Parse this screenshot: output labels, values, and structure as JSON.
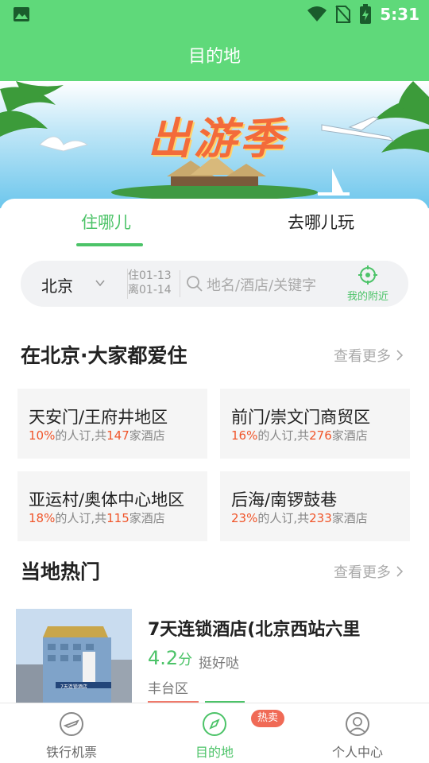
{
  "status_bar": {
    "time": "5:31"
  },
  "header": {
    "title": "目的地"
  },
  "banner": {
    "title": "出游季"
  },
  "tabs": [
    {
      "label": "住哪儿",
      "active": true
    },
    {
      "label": "去哪儿玩",
      "active": false
    }
  ],
  "search": {
    "city": "北京",
    "checkin": "住01-13",
    "checkout": "离01-14",
    "placeholder": "地名/酒店/关键字",
    "nearby_label": "我的附近"
  },
  "popular_section": {
    "title": "在北京·大家都爱住",
    "more": "查看更多"
  },
  "popular_areas": [
    {
      "name": "天安门/王府井地区",
      "percent": "10%",
      "mid": "的人订,共",
      "count": "147",
      "suffix": "家酒店"
    },
    {
      "name": "前门/崇文门商贸区",
      "percent": "16%",
      "mid": "的人订,共",
      "count": "276",
      "suffix": "家酒店"
    },
    {
      "name": "亚运村/奥体中心地区",
      "percent": "18%",
      "mid": "的人订,共",
      "count": "115",
      "suffix": "家酒店"
    },
    {
      "name": "后海/南锣鼓巷",
      "percent": "23%",
      "mid": "的人订,共",
      "count": "233",
      "suffix": "家酒店"
    }
  ],
  "local_section": {
    "title": "当地热门",
    "more": "查看更多"
  },
  "hotel": {
    "name": "7天连锁酒店(北京西站六里",
    "score": "4.2",
    "score_unit": "分",
    "comment": "挺好哒",
    "district": "丰台区",
    "sign_text": "7天连锁酒店"
  },
  "bottom_nav": {
    "items": [
      {
        "label": "铁行机票",
        "icon": "plane-ticket-icon",
        "active": false
      },
      {
        "label": "目的地",
        "icon": "compass-icon",
        "active": true
      },
      {
        "label": "个人中心",
        "icon": "user-icon",
        "active": false
      }
    ],
    "badge": "热卖"
  },
  "colors": {
    "primary_green": "#5fd97a",
    "accent_green": "#4cc368",
    "highlight_orange": "#f0552a",
    "badge_red": "#f06a56"
  }
}
